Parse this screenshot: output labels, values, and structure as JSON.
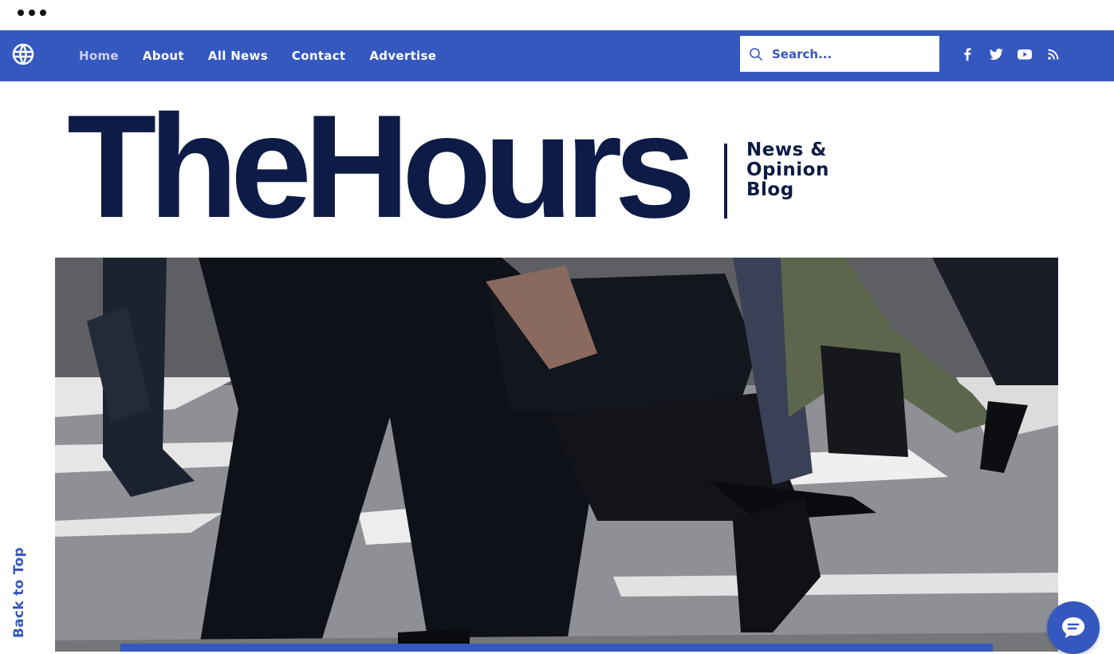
{
  "nav": {
    "items": [
      {
        "label": "Home"
      },
      {
        "label": "About"
      },
      {
        "label": "All News"
      },
      {
        "label": "Contact"
      },
      {
        "label": "Advertise"
      }
    ],
    "search_placeholder": "Search...",
    "social_icons": [
      "facebook-icon",
      "twitter-icon",
      "youtube-icon",
      "rss-icon"
    ]
  },
  "masthead": {
    "title": "TheHours",
    "tagline": "News & Opinion Blog"
  },
  "sidebar": {
    "back_to_top": "Back to Top"
  },
  "colors": {
    "brand_blue": "#3558be",
    "navy": "#0d1b46",
    "white": "#ffffff"
  }
}
